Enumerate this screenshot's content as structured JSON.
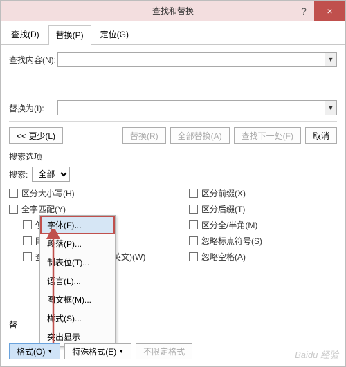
{
  "title": "查找和替换",
  "titlebar": {
    "help": "?",
    "close": "×"
  },
  "tabs": {
    "find": "查找(D)",
    "replace": "替换(P)",
    "goto": "定位(G)"
  },
  "fields": {
    "find_label": "查找内容(N):",
    "find_value": "",
    "replace_label": "替换为(I):",
    "replace_value": ""
  },
  "buttons": {
    "less": "<< 更少(L)",
    "replace": "替换(R)",
    "replace_all": "全部替换(A)",
    "find_next": "查找下一处(F)",
    "cancel": "取消"
  },
  "search_options_title": "搜索选项",
  "search_scope": {
    "label": "搜索:",
    "value": "全部"
  },
  "checks_left": [
    "区分大小写(H)",
    "全字匹配(Y)",
    "使用通配符(U)",
    "同音(英文)(K)",
    "查找单词的所有形式(英文)(W)"
  ],
  "checks_right": [
    "区分前缀(X)",
    "区分后缀(T)",
    "区分全/半角(M)",
    "忽略标点符号(S)",
    "忽略空格(A)"
  ],
  "format_menu": {
    "items": [
      "字体(F)...",
      "段落(P)...",
      "制表位(T)...",
      "语言(L)...",
      "图文框(M)...",
      "样式(S)...",
      "突出显示"
    ]
  },
  "replace_section_marker": "替",
  "bottom": {
    "format": "格式(O)",
    "special": "特殊格式(E)",
    "no_format": "不限定格式"
  },
  "watermark": "Baidu 经验"
}
